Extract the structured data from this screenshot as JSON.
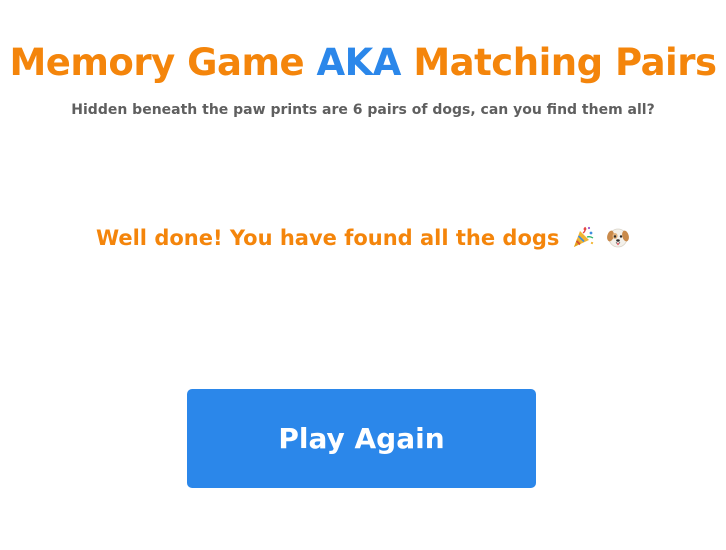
{
  "header": {
    "title_part1": "Memory Game ",
    "title_part2": "AKA",
    "title_part3": " Matching Pairs",
    "subtitle": "Hidden beneath the paw prints are 6 pairs of dogs, can you find them all?"
  },
  "result": {
    "message": "Well done! You have found all the dogs",
    "icons": [
      "party-popper-icon",
      "dog-face-icon"
    ]
  },
  "actions": {
    "play_again_label": "Play Again"
  },
  "colors": {
    "accent_orange": "#f4850b",
    "accent_blue": "#2b87ea",
    "subtitle_gray": "#5f5f5f",
    "button_text": "#ffffff",
    "background": "#ffffff"
  }
}
